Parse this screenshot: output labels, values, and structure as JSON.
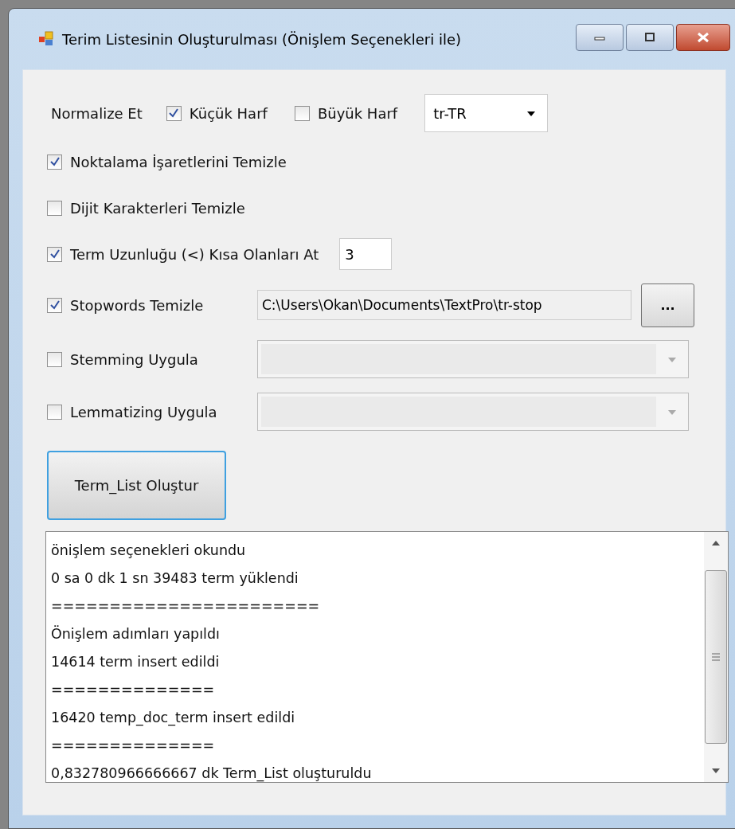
{
  "window": {
    "title": "Terim Listesinin Oluşturulması (Önişlem Seçenekleri ile)"
  },
  "normalize": {
    "label": "Normalize Et",
    "options": [
      {
        "label": "Küçük Harf",
        "checked": true
      },
      {
        "label": "Büyük Harf",
        "checked": false
      }
    ],
    "culture": "tr-TR"
  },
  "options": [
    {
      "kind": "plain",
      "label": "Noktalama İşaretlerini Temizle",
      "checked": true
    },
    {
      "kind": "plain",
      "label": "Dijit Karakterleri Temizle",
      "checked": false
    },
    {
      "kind": "number",
      "label": "Term Uzunluğu (<) Kısa Olanları At",
      "checked": true,
      "value": "3"
    },
    {
      "kind": "file",
      "label": "Stopwords Temizle",
      "checked": true,
      "value": "C:\\Users\\Okan\\Documents\\TextPro\\tr-stop",
      "button": "..."
    },
    {
      "kind": "combo",
      "label": "Stemming Uygula",
      "checked": false,
      "disabled": true
    },
    {
      "kind": "combo",
      "label": "Lemmatizing Uygula",
      "checked": false,
      "disabled": true
    }
  ],
  "run_button": "Term_List Oluştur",
  "log": [
    "önişlem seçenekleri okundu",
    "0 sa 0 dk 1 sn 39483 term yüklendi",
    "=======================",
    "Önişlem adımları yapıldı",
    "14614 term insert edildi",
    "==============",
    "16420 temp_doc_term insert edildi",
    "==============",
    "0,832780966666667 dk Term_List oluşturuldu"
  ]
}
